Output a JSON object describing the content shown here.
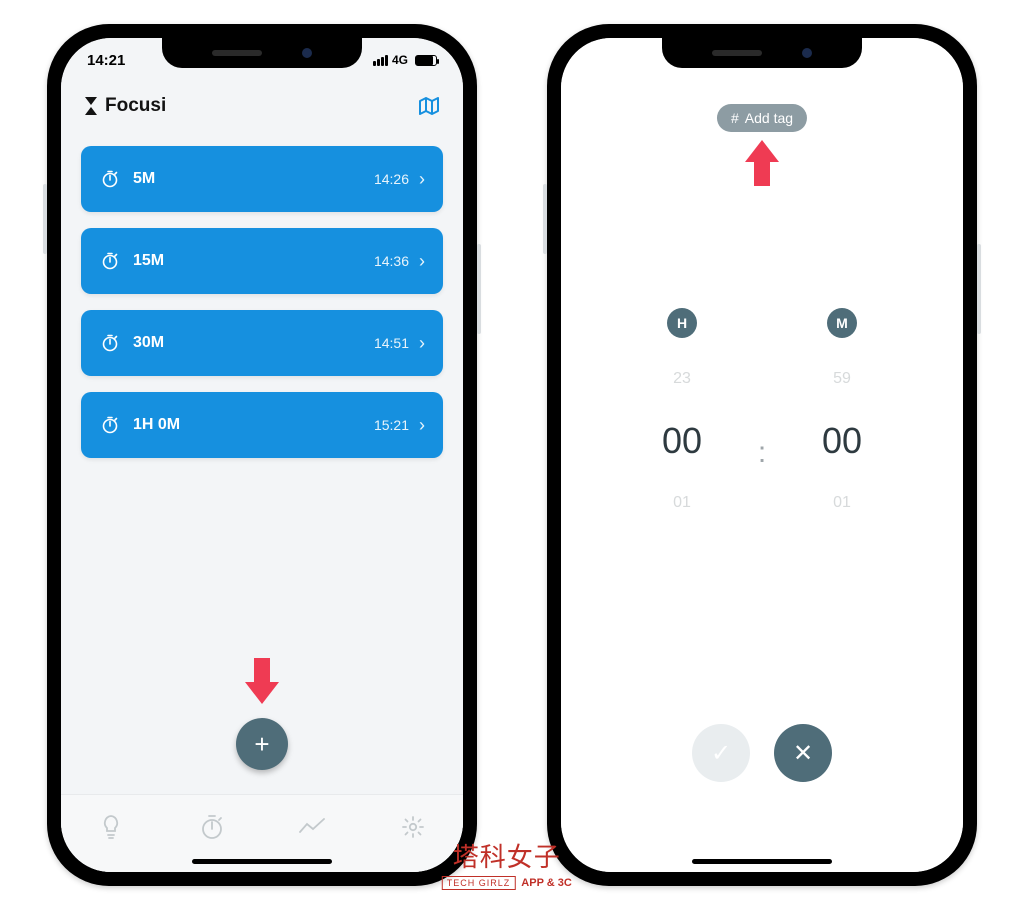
{
  "status": {
    "time": "14:21",
    "net": "4G"
  },
  "app": {
    "title": "Focusi"
  },
  "timers": [
    {
      "label": "5M",
      "end": "14:26"
    },
    {
      "label": "15M",
      "end": "14:36"
    },
    {
      "label": "30M",
      "end": "14:51"
    },
    {
      "label": "1H 0M",
      "end": "15:21"
    }
  ],
  "fab": {
    "glyph": "+"
  },
  "tag": {
    "hash": "#",
    "label": "Add tag"
  },
  "picker": {
    "h_unit": "H",
    "m_unit": "M",
    "h_prev": "23",
    "m_prev": "59",
    "h_cur": "00",
    "m_cur": "00",
    "h_next": "01",
    "m_next": "01",
    "colon": ":"
  },
  "actions": {
    "ok": "✓",
    "cancel": "✕"
  },
  "watermark": {
    "cn": "塔科女子",
    "box": "TECH GIRLZ",
    "en": "APP & 3C"
  }
}
